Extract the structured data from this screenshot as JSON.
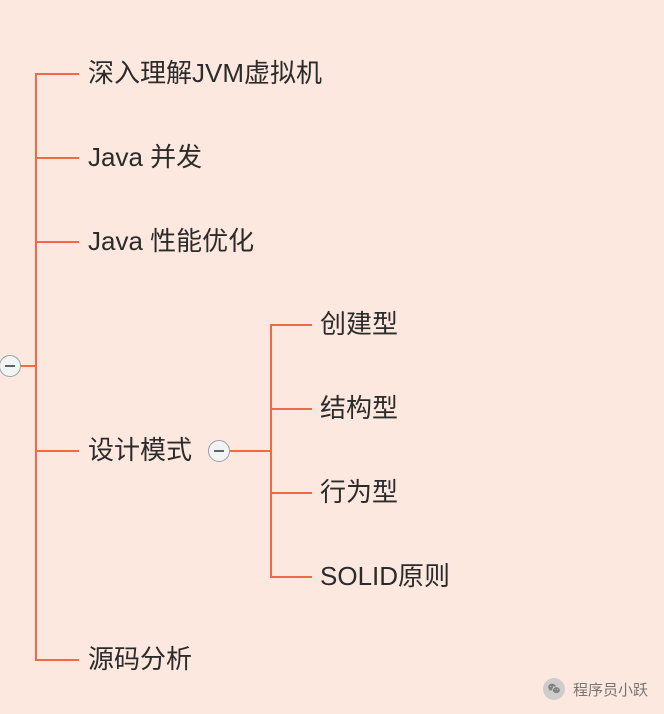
{
  "colors": {
    "background": "#fce8de",
    "connector": "#ef6a45",
    "text": "#2b2b2b"
  },
  "mindmap": {
    "root_collapsed": false,
    "level1": [
      {
        "label": "深入理解JVM虚拟机"
      },
      {
        "label": "Java 并发"
      },
      {
        "label": "Java 性能优化"
      },
      {
        "label": "设计模式",
        "collapsed": false,
        "children": [
          {
            "label": "创建型"
          },
          {
            "label": "结构型"
          },
          {
            "label": "行为型"
          },
          {
            "label": "SOLID原则"
          }
        ]
      },
      {
        "label": "源码分析"
      }
    ]
  },
  "watermark": {
    "text": "程序员小跃",
    "icon": "wechat-icon"
  }
}
